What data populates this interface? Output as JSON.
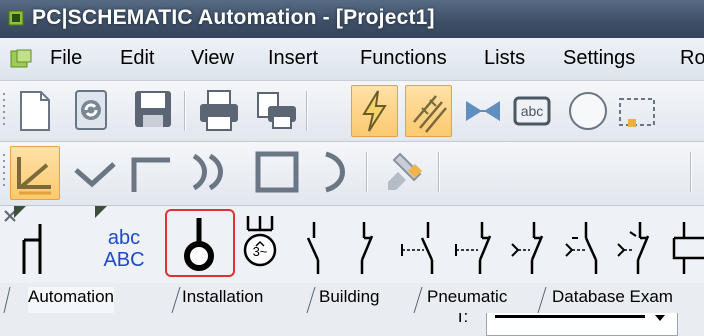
{
  "window": {
    "title": "PC|SCHEMATIC Automation - [Project1]"
  },
  "menu": {
    "items": [
      "File",
      "Edit",
      "View",
      "Insert",
      "Functions",
      "Lists",
      "Settings",
      "Ro"
    ]
  },
  "toolbar_line": {
    "text_label": "T:"
  },
  "symbols": {
    "text_symbol_top": "abc",
    "text_symbol_bottom": "ABC"
  },
  "tabs": [
    "Automation",
    "Installation",
    "Building",
    "Pneumatic",
    "Database Exam"
  ],
  "colors": {
    "titlebar": "#3d4f66",
    "active_button": "#fcc96f",
    "selection_outline": "#e0332f"
  }
}
